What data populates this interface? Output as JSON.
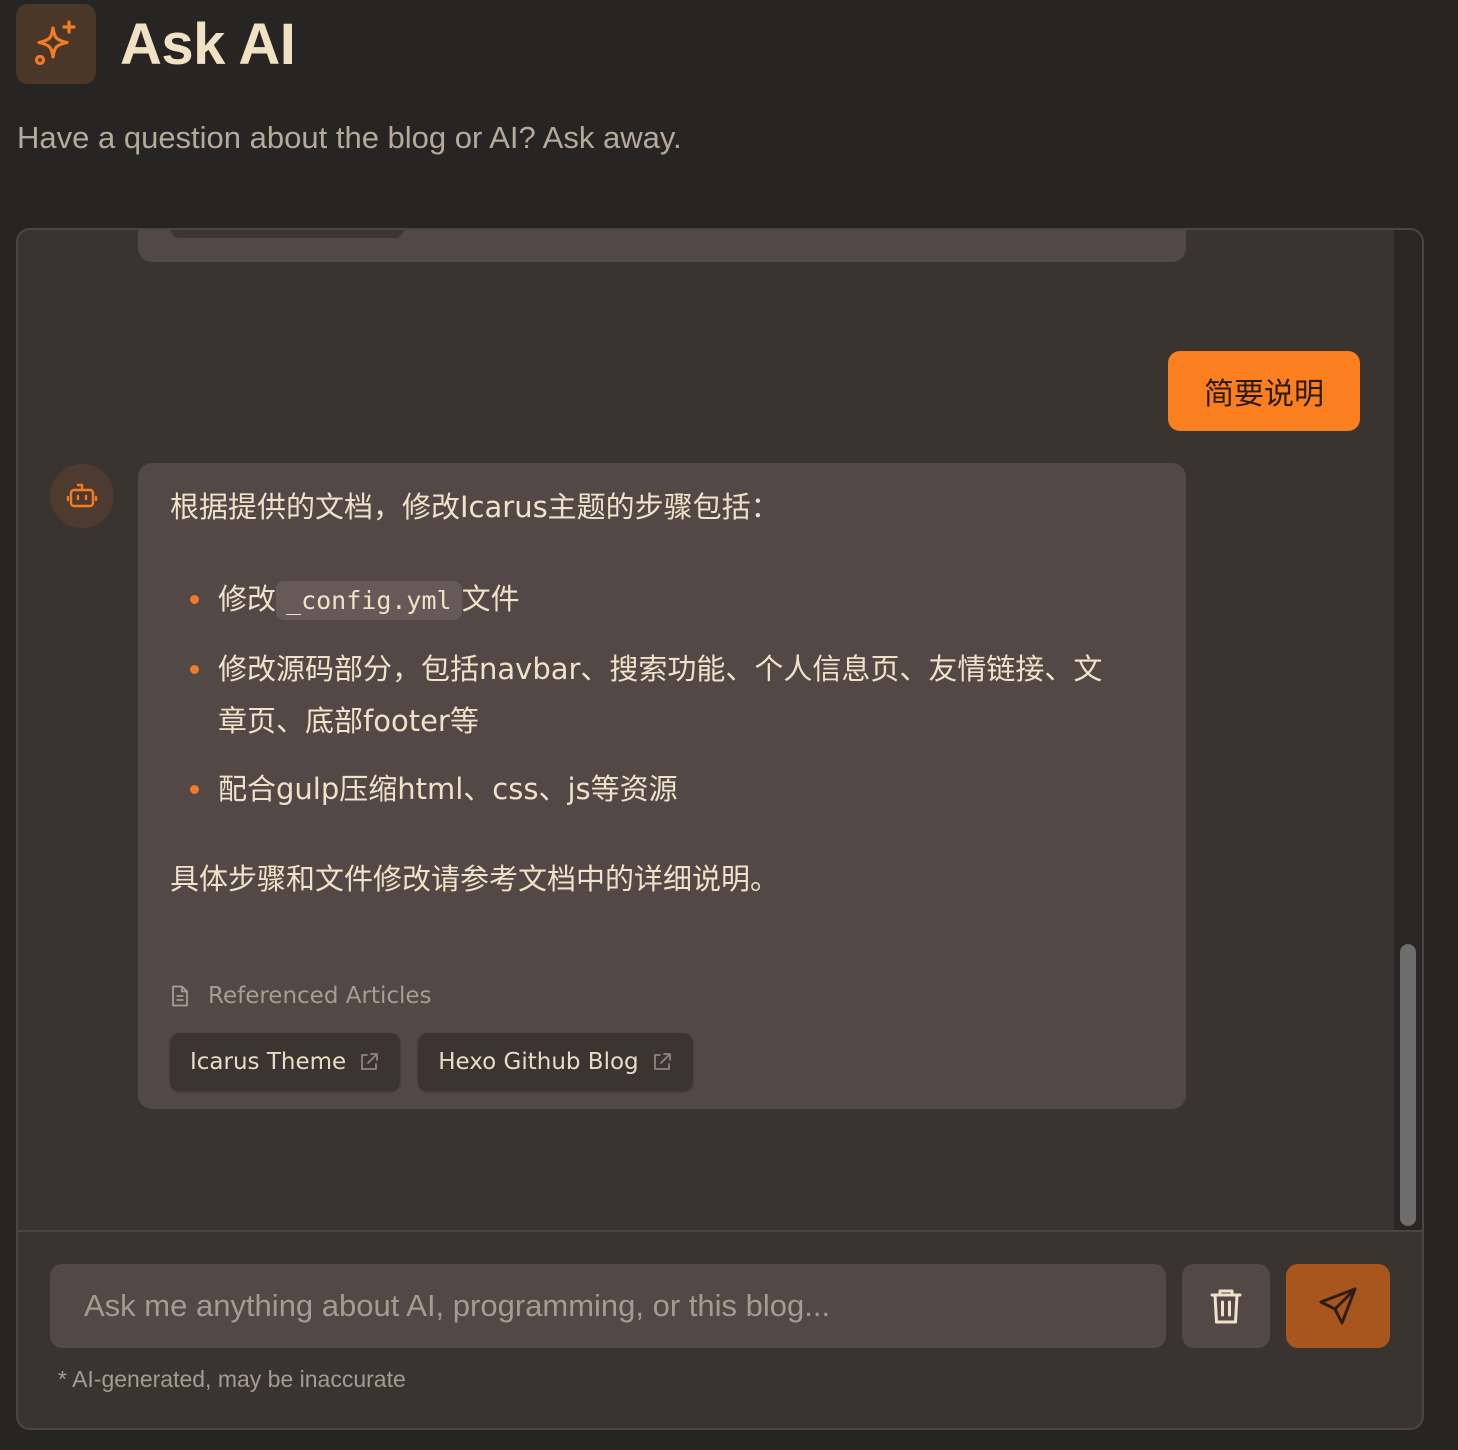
{
  "header": {
    "title": "Ask AI",
    "subtitle": "Have a question about the blog or AI? Ask away.",
    "icon": "sparkles-icon"
  },
  "conversation": {
    "user_message": "简要说明",
    "ai_reply": {
      "intro": "根据提供的文档，修改Icarus主题的步骤包括：",
      "items": [
        {
          "before": "修改",
          "code": "_config.yml",
          "after": "文件"
        },
        {
          "text": "修改源码部分，包括navbar、搜索功能、个人信息页、友情链接、文章页、底部footer等"
        },
        {
          "text": "配合gulp压缩html、css、js等资源"
        }
      ],
      "outro": "具体步骤和文件修改请参考文档中的详细说明。",
      "references_label": "Referenced Articles",
      "references": [
        "Icarus Theme",
        "Hexo Github Blog"
      ]
    }
  },
  "input": {
    "placeholder": "Ask me anything about AI, programming, or this blog...",
    "value": "",
    "disclaimer": "* AI-generated, may be inaccurate"
  },
  "colors": {
    "accent": "#fb7f1e",
    "send_button": "#a9561e",
    "background": "#272524",
    "panel": "#3a3431",
    "bubble": "#524845"
  }
}
